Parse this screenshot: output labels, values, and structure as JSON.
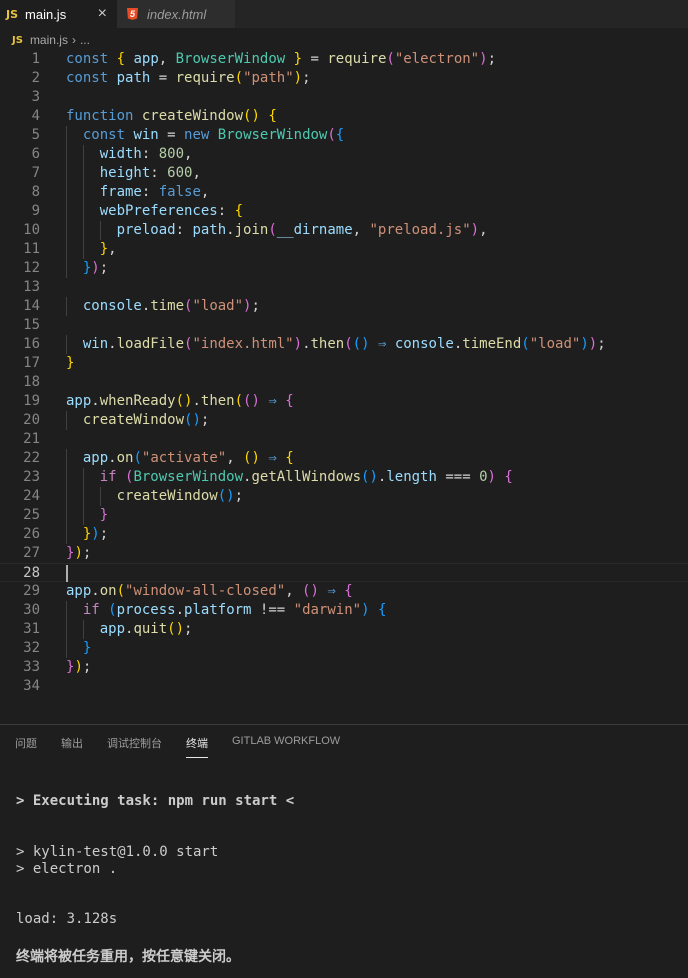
{
  "tabs": {
    "active": {
      "badge": "JS",
      "label": "main.js",
      "close": "×"
    },
    "inactive": {
      "badge": "5",
      "label": "index.html"
    }
  },
  "breadcrumb": {
    "badge": "JS",
    "file": "main.js",
    "sep": "›",
    "more": "..."
  },
  "code": {
    "current_line": 28,
    "lines": [
      [
        [
          "kw",
          "const"
        ],
        [
          "pl",
          " "
        ],
        [
          "b1",
          "{"
        ],
        [
          "pl",
          " "
        ],
        [
          "var",
          "app"
        ],
        [
          "pl",
          ", "
        ],
        [
          "cls",
          "BrowserWindow"
        ],
        [
          "pl",
          " "
        ],
        [
          "b1",
          "}"
        ],
        [
          "pl",
          " = "
        ],
        [
          "fn",
          "require"
        ],
        [
          "b2",
          "("
        ],
        [
          "str",
          "\"electron\""
        ],
        [
          "b2",
          ")"
        ],
        [
          "pl",
          ";"
        ]
      ],
      [
        [
          "kw",
          "const"
        ],
        [
          "pl",
          " "
        ],
        [
          "var",
          "path"
        ],
        [
          "pl",
          " = "
        ],
        [
          "fn",
          "require"
        ],
        [
          "b1",
          "("
        ],
        [
          "str",
          "\"path\""
        ],
        [
          "b1",
          ")"
        ],
        [
          "pl",
          ";"
        ]
      ],
      [],
      [
        [
          "kw",
          "function"
        ],
        [
          "pl",
          " "
        ],
        [
          "fn",
          "createWindow"
        ],
        [
          "b1",
          "()"
        ],
        [
          "pl",
          " "
        ],
        [
          "b1",
          "{"
        ]
      ],
      [
        [
          "pl",
          "  "
        ],
        [
          "kw",
          "const"
        ],
        [
          "pl",
          " "
        ],
        [
          "var",
          "win"
        ],
        [
          "pl",
          " = "
        ],
        [
          "kw",
          "new"
        ],
        [
          "pl",
          " "
        ],
        [
          "cls",
          "BrowserWindow"
        ],
        [
          "b2",
          "("
        ],
        [
          "b3",
          "{"
        ]
      ],
      [
        [
          "pl",
          "    "
        ],
        [
          "var",
          "width"
        ],
        [
          "pl",
          ": "
        ],
        [
          "num",
          "800"
        ],
        [
          "pl",
          ","
        ]
      ],
      [
        [
          "pl",
          "    "
        ],
        [
          "var",
          "height"
        ],
        [
          "pl",
          ": "
        ],
        [
          "num",
          "600"
        ],
        [
          "pl",
          ","
        ]
      ],
      [
        [
          "pl",
          "    "
        ],
        [
          "var",
          "frame"
        ],
        [
          "pl",
          ": "
        ],
        [
          "kw",
          "false"
        ],
        [
          "pl",
          ","
        ]
      ],
      [
        [
          "pl",
          "    "
        ],
        [
          "var",
          "webPreferences"
        ],
        [
          "pl",
          ": "
        ],
        [
          "b1",
          "{"
        ]
      ],
      [
        [
          "pl",
          "      "
        ],
        [
          "var",
          "preload"
        ],
        [
          "pl",
          ": "
        ],
        [
          "var",
          "path"
        ],
        [
          "pl",
          "."
        ],
        [
          "fn",
          "join"
        ],
        [
          "b2",
          "("
        ],
        [
          "var",
          "__dirname"
        ],
        [
          "pl",
          ", "
        ],
        [
          "str",
          "\"preload.js\""
        ],
        [
          "b2",
          ")"
        ],
        [
          "pl",
          ","
        ]
      ],
      [
        [
          "pl",
          "    "
        ],
        [
          "b1",
          "}"
        ],
        [
          "pl",
          ","
        ]
      ],
      [
        [
          "pl",
          "  "
        ],
        [
          "b3",
          "}"
        ],
        [
          "b2",
          ")"
        ],
        [
          "pl",
          ";"
        ]
      ],
      [],
      [
        [
          "pl",
          "  "
        ],
        [
          "var",
          "console"
        ],
        [
          "pl",
          "."
        ],
        [
          "fn",
          "time"
        ],
        [
          "b2",
          "("
        ],
        [
          "str",
          "\"load\""
        ],
        [
          "b2",
          ")"
        ],
        [
          "pl",
          ";"
        ]
      ],
      [],
      [
        [
          "pl",
          "  "
        ],
        [
          "var",
          "win"
        ],
        [
          "pl",
          "."
        ],
        [
          "fn",
          "loadFile"
        ],
        [
          "b2",
          "("
        ],
        [
          "str",
          "\"index.html\""
        ],
        [
          "b2",
          ")"
        ],
        [
          "pl",
          "."
        ],
        [
          "fn",
          "then"
        ],
        [
          "b2",
          "("
        ],
        [
          "b3",
          "()"
        ],
        [
          "pl",
          " "
        ],
        [
          "kw",
          "⇒"
        ],
        [
          "pl",
          " "
        ],
        [
          "var",
          "console"
        ],
        [
          "pl",
          "."
        ],
        [
          "fn",
          "timeEnd"
        ],
        [
          "b3",
          "("
        ],
        [
          "str",
          "\"load\""
        ],
        [
          "b3",
          ")"
        ],
        [
          "b2",
          ")"
        ],
        [
          "pl",
          ";"
        ]
      ],
      [
        [
          "b1",
          "}"
        ]
      ],
      [],
      [
        [
          "var",
          "app"
        ],
        [
          "pl",
          "."
        ],
        [
          "fn",
          "whenReady"
        ],
        [
          "b1",
          "()"
        ],
        [
          "pl",
          "."
        ],
        [
          "fn",
          "then"
        ],
        [
          "b1",
          "("
        ],
        [
          "b2",
          "()"
        ],
        [
          "pl",
          " "
        ],
        [
          "kw",
          "⇒"
        ],
        [
          "pl",
          " "
        ],
        [
          "b2",
          "{"
        ]
      ],
      [
        [
          "pl",
          "  "
        ],
        [
          "fn",
          "createWindow"
        ],
        [
          "b3",
          "()"
        ],
        [
          "pl",
          ";"
        ]
      ],
      [],
      [
        [
          "pl",
          "  "
        ],
        [
          "var",
          "app"
        ],
        [
          "pl",
          "."
        ],
        [
          "fn",
          "on"
        ],
        [
          "b3",
          "("
        ],
        [
          "str",
          "\"activate\""
        ],
        [
          "pl",
          ", "
        ],
        [
          "b1",
          "()"
        ],
        [
          "pl",
          " "
        ],
        [
          "kw",
          "⇒"
        ],
        [
          "pl",
          " "
        ],
        [
          "b1",
          "{"
        ]
      ],
      [
        [
          "pl",
          "    "
        ],
        [
          "ctrl",
          "if"
        ],
        [
          "pl",
          " "
        ],
        [
          "b2",
          "("
        ],
        [
          "cls",
          "BrowserWindow"
        ],
        [
          "pl",
          "."
        ],
        [
          "fn",
          "getAllWindows"
        ],
        [
          "b3",
          "()"
        ],
        [
          "pl",
          "."
        ],
        [
          "var",
          "length"
        ],
        [
          "pl",
          " === "
        ],
        [
          "num",
          "0"
        ],
        [
          "b2",
          ")"
        ],
        [
          "pl",
          " "
        ],
        [
          "b2",
          "{"
        ]
      ],
      [
        [
          "pl",
          "      "
        ],
        [
          "fn",
          "createWindow"
        ],
        [
          "b3",
          "()"
        ],
        [
          "pl",
          ";"
        ]
      ],
      [
        [
          "pl",
          "    "
        ],
        [
          "b2",
          "}"
        ]
      ],
      [
        [
          "pl",
          "  "
        ],
        [
          "b1",
          "}"
        ],
        [
          "b3",
          ")"
        ],
        [
          "pl",
          ";"
        ]
      ],
      [
        [
          "b2",
          "}"
        ],
        [
          "b1",
          ")"
        ],
        [
          "pl",
          ";"
        ]
      ],
      [],
      [
        [
          "var",
          "app"
        ],
        [
          "pl",
          "."
        ],
        [
          "fn",
          "on"
        ],
        [
          "b1",
          "("
        ],
        [
          "str",
          "\"window-all-closed\""
        ],
        [
          "pl",
          ", "
        ],
        [
          "b2",
          "()"
        ],
        [
          "pl",
          " "
        ],
        [
          "kw",
          "⇒"
        ],
        [
          "pl",
          " "
        ],
        [
          "b2",
          "{"
        ]
      ],
      [
        [
          "pl",
          "  "
        ],
        [
          "ctrl",
          "if"
        ],
        [
          "pl",
          " "
        ],
        [
          "b3",
          "("
        ],
        [
          "var",
          "process"
        ],
        [
          "pl",
          "."
        ],
        [
          "var",
          "platform"
        ],
        [
          "pl",
          " !== "
        ],
        [
          "str",
          "\"darwin\""
        ],
        [
          "b3",
          ")"
        ],
        [
          "pl",
          " "
        ],
        [
          "b3",
          "{"
        ]
      ],
      [
        [
          "pl",
          "    "
        ],
        [
          "var",
          "app"
        ],
        [
          "pl",
          "."
        ],
        [
          "fn",
          "quit"
        ],
        [
          "b1",
          "()"
        ],
        [
          "pl",
          ";"
        ]
      ],
      [
        [
          "pl",
          "  "
        ],
        [
          "b3",
          "}"
        ]
      ],
      [
        [
          "b2",
          "}"
        ],
        [
          "b1",
          ")"
        ],
        [
          "pl",
          ";"
        ]
      ],
      []
    ]
  },
  "panel": {
    "tabs": [
      "问题",
      "输出",
      "调试控制台",
      "终端",
      "GITLAB WORKFLOW"
    ],
    "active_tab": 3
  },
  "terminal": {
    "task": "> Executing task: npm run start <",
    "line1": "> kylin-test@1.0.0 start",
    "line2": "> electron .",
    "load": "load: 3.128s",
    "reuse": "终端将被任务重用，按任意键关闭。"
  },
  "colors": {
    "background": "#1e1e1e",
    "keyword": "#569cd6",
    "string": "#ce9178",
    "function": "#dcdcaa",
    "variable": "#9cdcfe",
    "class": "#4ec9b0",
    "js_badge": "#e8c33f",
    "html_badge": "#e44d26"
  }
}
